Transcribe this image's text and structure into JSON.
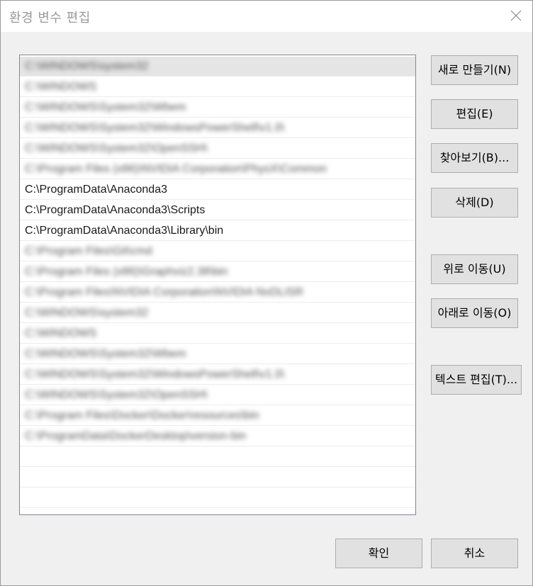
{
  "window": {
    "title": "환경 변수 편집",
    "close_icon": "close-icon"
  },
  "list": {
    "items": [
      {
        "label": "C:\\WINDOWS\\system32",
        "blurred": true,
        "selected": true
      },
      {
        "label": "C:\\WINDOWS",
        "blurred": true
      },
      {
        "label": "C:\\WINDOWS\\System32\\Wbem",
        "blurred": true
      },
      {
        "label": "C:\\WINDOWS\\System32\\WindowsPowerShell\\v1.0\\",
        "blurred": true
      },
      {
        "label": "C:\\WINDOWS\\System32\\OpenSSH\\",
        "blurred": true
      },
      {
        "label": "C:\\Program Files (x86)\\NVIDIA Corporation\\PhysX\\Common",
        "blurred": true
      },
      {
        "label": "C:\\ProgramData\\Anaconda3",
        "blurred": false
      },
      {
        "label": "C:\\ProgramData\\Anaconda3\\Scripts",
        "blurred": false
      },
      {
        "label": "C:\\ProgramData\\Anaconda3\\Library\\bin",
        "blurred": false
      },
      {
        "label": "C:\\Program Files\\Git\\cmd",
        "blurred": true
      },
      {
        "label": "C:\\Program Files (x86)\\Graphviz2.38\\bin",
        "blurred": true
      },
      {
        "label": "C:\\Program Files\\NVIDIA Corporation\\NVIDIA NvDLISR",
        "blurred": true
      },
      {
        "label": "C:\\WINDOWS\\system32",
        "blurred": true
      },
      {
        "label": "C:\\WINDOWS",
        "blurred": true
      },
      {
        "label": "C:\\WINDOWS\\System32\\Wbem",
        "blurred": true
      },
      {
        "label": "C:\\WINDOWS\\System32\\WindowsPowerShell\\v1.0\\",
        "blurred": true
      },
      {
        "label": "C:\\WINDOWS\\System32\\OpenSSH\\",
        "blurred": true
      },
      {
        "label": "C:\\Program Files\\Docker\\Docker\\resources\\bin",
        "blurred": true
      },
      {
        "label": "C:\\ProgramData\\DockerDesktop\\version-bin",
        "blurred": true
      },
      {
        "label": "",
        "blurred": false
      },
      {
        "label": "",
        "blurred": false
      },
      {
        "label": "",
        "blurred": false
      }
    ]
  },
  "buttons": {
    "new": "새로 만들기(N)",
    "edit": "편집(E)",
    "browse": "찾아보기(B)...",
    "delete": "삭제(D)",
    "move_up": "위로 이동(U)",
    "move_down": "아래로 이동(O)",
    "edit_text": "텍스트 편집(T)...",
    "ok": "확인",
    "cancel": "취소"
  }
}
